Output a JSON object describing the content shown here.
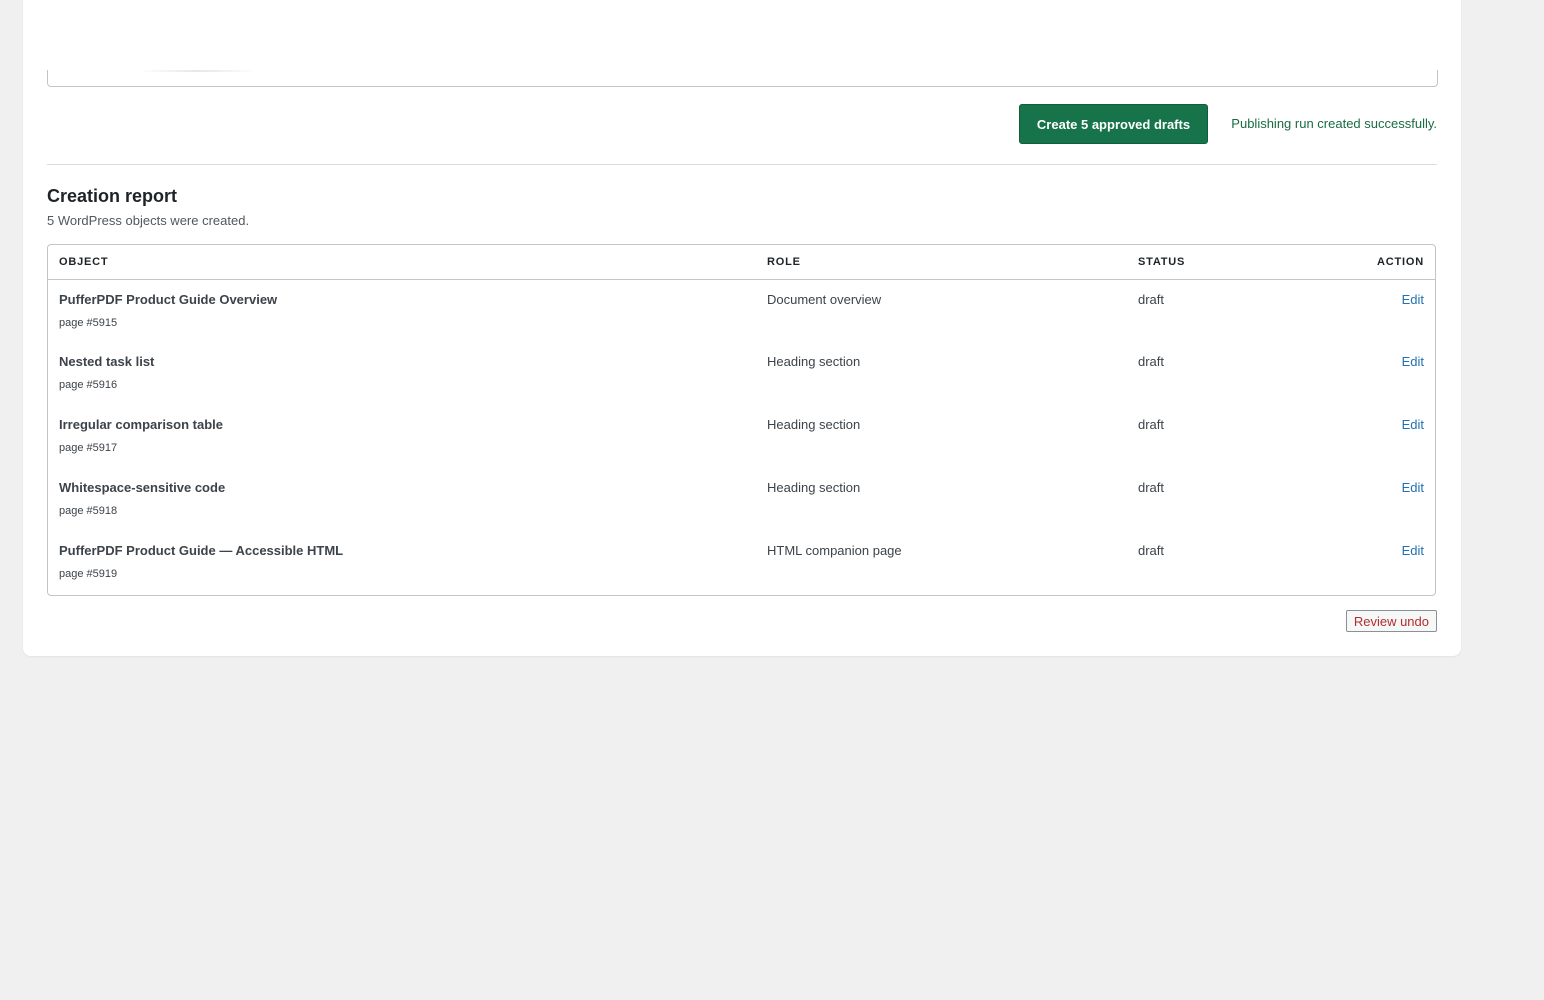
{
  "actions": {
    "create_button_label": "Create 5 approved drafts",
    "success_message": "Publishing run created successfully."
  },
  "report": {
    "title": "Creation report",
    "summary": "5 WordPress objects were created.",
    "columns": {
      "object": "OBJECT",
      "role": "ROLE",
      "status": "STATUS",
      "action": "ACTION"
    },
    "rows": [
      {
        "title": "PufferPDF Product Guide Overview",
        "meta": "page #5915",
        "role": "Document overview",
        "status": "draft",
        "action": "Edit"
      },
      {
        "title": "Nested task list",
        "meta": "page #5916",
        "role": "Heading section",
        "status": "draft",
        "action": "Edit"
      },
      {
        "title": "Irregular comparison table",
        "meta": "page #5917",
        "role": "Heading section",
        "status": "draft",
        "action": "Edit"
      },
      {
        "title": "Whitespace-sensitive code",
        "meta": "page #5918",
        "role": "Heading section",
        "status": "draft",
        "action": "Edit"
      },
      {
        "title": "PufferPDF Product Guide — Accessible HTML",
        "meta": "page #5919",
        "role": "HTML companion page",
        "status": "draft",
        "action": "Edit"
      }
    ],
    "undo_button_label": "Review undo"
  },
  "colors": {
    "primary": "#17734a",
    "success_text": "#1a6b43",
    "link": "#2271b1",
    "danger": "#b32d2e",
    "page_background": "#f0f0f1"
  }
}
